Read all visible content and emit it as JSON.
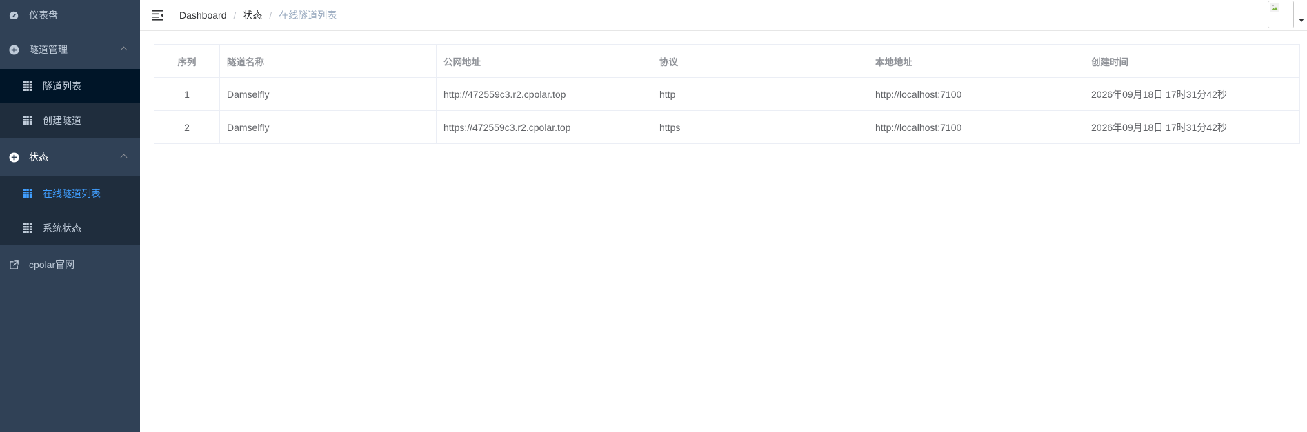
{
  "sidebar": {
    "dashboard": "仪表盘",
    "tunnel_mgmt": {
      "label": "隧道管理",
      "items": [
        "隧道列表",
        "创建隧道"
      ]
    },
    "status": {
      "label": "状态",
      "items": [
        "在线隧道列表",
        "系统状态"
      ]
    },
    "official_site": "cpolar官网"
  },
  "header": {
    "breadcrumb": [
      "Dashboard",
      "状态",
      "在线隧道列表"
    ],
    "separator": "/"
  },
  "table": {
    "columns": [
      "序列",
      "隧道名称",
      "公网地址",
      "协议",
      "本地地址",
      "创建时间"
    ],
    "rows": [
      [
        "1",
        "Damselfly",
        "http://472559c3.r2.cpolar.top",
        "http",
        "http://localhost:7100",
        "2026年09月18日 17时31分42秒"
      ],
      [
        "2",
        "Damselfly",
        "https://472559c3.r2.cpolar.top",
        "https",
        "http://localhost:7100",
        "2026年09月18日 17时31分42秒"
      ]
    ]
  },
  "colors": {
    "sidebar_bg": "#304156",
    "submenu_bg": "#1f2d3d",
    "active_text": "#409eff",
    "menu_text": "#bfcbd9"
  }
}
